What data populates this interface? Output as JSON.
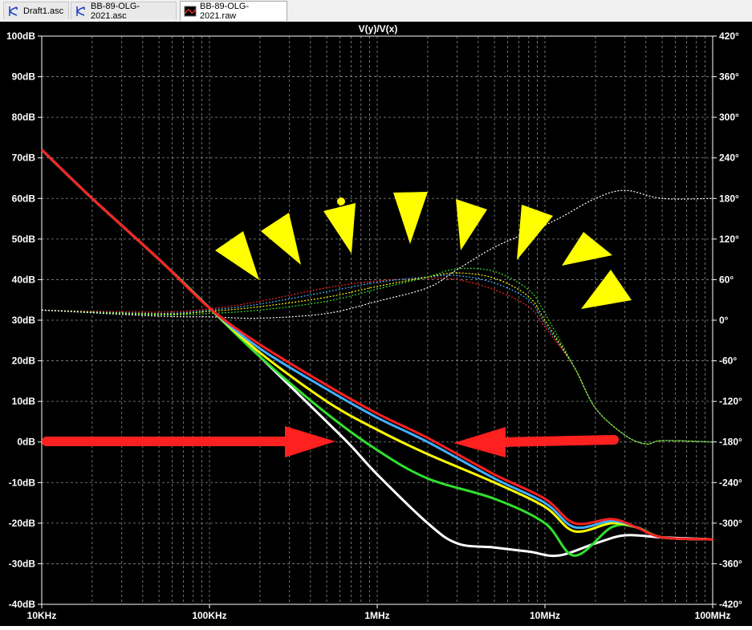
{
  "tabs": [
    {
      "label": "Draft1.asc",
      "icon": "schematic-icon",
      "active": false
    },
    {
      "label": "BB-89-OLG-2021.asc",
      "icon": "schematic-icon",
      "active": false
    },
    {
      "label": "BB-89-OLG-2021.raw",
      "icon": "waveform-icon",
      "active": true
    }
  ],
  "colors": {
    "background": "#000000",
    "grid": "#8c8c8c",
    "axis_text": "#ffffff",
    "annotation_arrows": "#ff2020",
    "annotation_triangles": "#ffff00"
  },
  "chart_data": {
    "type": "line",
    "title": "V(y)/V(x)",
    "x_scale": "log",
    "xlim_hz": [
      10000,
      100000000
    ],
    "x_ticks": [
      "10KHz",
      "100KHz",
      "1MHz",
      "10MHz",
      "100MHz"
    ],
    "left_axis": {
      "unit": "dB",
      "ylim": [
        -40,
        100
      ],
      "ticks": [
        "100dB",
        "90dB",
        "80dB",
        "70dB",
        "60dB",
        "50dB",
        "40dB",
        "30dB",
        "20dB",
        "10dB",
        "0dB",
        "-10dB",
        "-20dB",
        "-30dB",
        "-40dB"
      ]
    },
    "right_axis": {
      "unit": "degrees",
      "ylim": [
        -420,
        420
      ],
      "ticks": [
        "420°",
        "360°",
        "300°",
        "240°",
        "180°",
        "120°",
        "60°",
        "0°",
        "-60°",
        "-120°",
        "-180°",
        "-240°",
        "-300°",
        "-360°",
        "-420°"
      ]
    },
    "grid": true,
    "legend": "none",
    "magnitude_series": [
      {
        "color": "#ff2020",
        "points": [
          [
            10000.0,
            72
          ],
          [
            20000.0,
            60
          ],
          [
            50000.0,
            45
          ],
          [
            100000.0,
            33
          ],
          [
            200000.0,
            24
          ],
          [
            500000.0,
            14
          ],
          [
            1000000.0,
            7
          ],
          [
            2000000.0,
            1
          ],
          [
            5000000.0,
            -8
          ],
          [
            10000000.0,
            -14
          ],
          [
            15000000.0,
            -20
          ],
          [
            25000000.0,
            -19
          ],
          [
            35000000.0,
            -21
          ],
          [
            50000000.0,
            -23.5
          ],
          [
            100000000.0,
            -24
          ]
        ]
      },
      {
        "color": "#40b0ff",
        "points": [
          [
            10000.0,
            72
          ],
          [
            20000.0,
            60
          ],
          [
            50000.0,
            45
          ],
          [
            100000.0,
            33
          ],
          [
            200000.0,
            23
          ],
          [
            500000.0,
            13
          ],
          [
            1000000.0,
            6
          ],
          [
            2000000.0,
            0
          ],
          [
            5000000.0,
            -9
          ],
          [
            10000000.0,
            -15
          ],
          [
            15000000.0,
            -21
          ],
          [
            25000000.0,
            -19.5
          ],
          [
            35000000.0,
            -21
          ],
          [
            50000000.0,
            -23.5
          ],
          [
            100000000.0,
            -24
          ]
        ]
      },
      {
        "color": "#ffff00",
        "points": [
          [
            10000.0,
            72
          ],
          [
            20000.0,
            60
          ],
          [
            50000.0,
            45
          ],
          [
            100000.0,
            33
          ],
          [
            200000.0,
            22
          ],
          [
            500000.0,
            10
          ],
          [
            1000000.0,
            3
          ],
          [
            2000000.0,
            -3
          ],
          [
            5000000.0,
            -10
          ],
          [
            10000000.0,
            -16
          ],
          [
            15000000.0,
            -22
          ],
          [
            25000000.0,
            -20
          ],
          [
            35000000.0,
            -21
          ],
          [
            50000000.0,
            -23.5
          ],
          [
            100000000.0,
            -24
          ]
        ]
      },
      {
        "color": "#30e030",
        "points": [
          [
            10000.0,
            72
          ],
          [
            20000.0,
            60
          ],
          [
            50000.0,
            45
          ],
          [
            100000.0,
            33
          ],
          [
            200000.0,
            21
          ],
          [
            500000.0,
            7
          ],
          [
            1000000.0,
            -2
          ],
          [
            2000000.0,
            -9
          ],
          [
            5000000.0,
            -14
          ],
          [
            10000000.0,
            -20
          ],
          [
            15000000.0,
            -28
          ],
          [
            25000000.0,
            -21
          ],
          [
            35000000.0,
            -21
          ],
          [
            50000000.0,
            -23.5
          ],
          [
            100000000.0,
            -24
          ]
        ]
      },
      {
        "color": "#ffffff",
        "points": [
          [
            10000.0,
            72
          ],
          [
            20000.0,
            60
          ],
          [
            50000.0,
            45
          ],
          [
            100000.0,
            33
          ],
          [
            200000.0,
            21
          ],
          [
            500000.0,
            5
          ],
          [
            700000.0,
            -1
          ],
          [
            1000000.0,
            -8
          ],
          [
            2000000.0,
            -20
          ],
          [
            3000000.0,
            -25
          ],
          [
            5000000.0,
            -26
          ],
          [
            8000000.0,
            -27
          ],
          [
            12000000.0,
            -28
          ],
          [
            20000000.0,
            -25
          ],
          [
            30000000.0,
            -23
          ],
          [
            50000000.0,
            -23.5
          ],
          [
            100000000.0,
            -24
          ]
        ]
      }
    ],
    "phase_series": [
      {
        "color": "#ff2020",
        "points": [
          [
            10000.0,
            15
          ],
          [
            50000.0,
            12
          ],
          [
            100000.0,
            17
          ],
          [
            200000.0,
            28
          ],
          [
            500000.0,
            48
          ],
          [
            1000000.0,
            58
          ],
          [
            2000000.0,
            62
          ],
          [
            3000000.0,
            60
          ],
          [
            5000000.0,
            45
          ],
          [
            8000000.0,
            20
          ],
          [
            10000000.0,
            -10
          ],
          [
            15000000.0,
            -70
          ],
          [
            20000000.0,
            -130
          ],
          [
            30000000.0,
            -170
          ],
          [
            40000000.0,
            -183
          ],
          [
            50000000.0,
            -178
          ],
          [
            100000000.0,
            -180
          ]
        ]
      },
      {
        "color": "#40b0ff",
        "points": [
          [
            10000.0,
            15
          ],
          [
            50000.0,
            10
          ],
          [
            100000.0,
            15
          ],
          [
            200000.0,
            24
          ],
          [
            500000.0,
            42
          ],
          [
            1000000.0,
            56
          ],
          [
            2000000.0,
            64
          ],
          [
            3000000.0,
            66
          ],
          [
            5000000.0,
            55
          ],
          [
            8000000.0,
            30
          ],
          [
            10000000.0,
            -5
          ],
          [
            15000000.0,
            -70
          ],
          [
            20000000.0,
            -130
          ],
          [
            30000000.0,
            -170
          ],
          [
            40000000.0,
            -183
          ],
          [
            50000000.0,
            -178
          ],
          [
            100000000.0,
            -180
          ]
        ]
      },
      {
        "color": "#ffff00",
        "points": [
          [
            10000.0,
            15
          ],
          [
            50000.0,
            9
          ],
          [
            100000.0,
            13
          ],
          [
            200000.0,
            20
          ],
          [
            500000.0,
            34
          ],
          [
            1000000.0,
            50
          ],
          [
            2000000.0,
            64
          ],
          [
            3000000.0,
            70
          ],
          [
            5000000.0,
            62
          ],
          [
            8000000.0,
            35
          ],
          [
            10000000.0,
            0
          ],
          [
            15000000.0,
            -70
          ],
          [
            20000000.0,
            -130
          ],
          [
            30000000.0,
            -170
          ],
          [
            40000000.0,
            -183
          ],
          [
            50000000.0,
            -178
          ],
          [
            100000000.0,
            -180
          ]
        ]
      },
      {
        "color": "#30e030",
        "points": [
          [
            10000.0,
            15
          ],
          [
            50000.0,
            8
          ],
          [
            100000.0,
            10
          ],
          [
            200000.0,
            15
          ],
          [
            500000.0,
            28
          ],
          [
            1000000.0,
            46
          ],
          [
            2000000.0,
            64
          ],
          [
            3000000.0,
            76
          ],
          [
            5000000.0,
            72
          ],
          [
            8000000.0,
            45
          ],
          [
            10000000.0,
            10
          ],
          [
            15000000.0,
            -70
          ],
          [
            20000000.0,
            -130
          ],
          [
            30000000.0,
            -170
          ],
          [
            40000000.0,
            -183
          ],
          [
            50000000.0,
            -178
          ],
          [
            100000000.0,
            -180
          ]
        ]
      },
      {
        "color": "#ffffff",
        "points": [
          [
            10000.0,
            15
          ],
          [
            50000.0,
            6
          ],
          [
            100000.0,
            5
          ],
          [
            200000.0,
            3
          ],
          [
            500000.0,
            10
          ],
          [
            1000000.0,
            28
          ],
          [
            2000000.0,
            48
          ],
          [
            3000000.0,
            75
          ],
          [
            5000000.0,
            108
          ],
          [
            8000000.0,
            130
          ],
          [
            12000000.0,
            150
          ],
          [
            20000000.0,
            180
          ],
          [
            30000000.0,
            192
          ],
          [
            50000000.0,
            180
          ],
          [
            100000000.0,
            180
          ]
        ]
      }
    ]
  }
}
